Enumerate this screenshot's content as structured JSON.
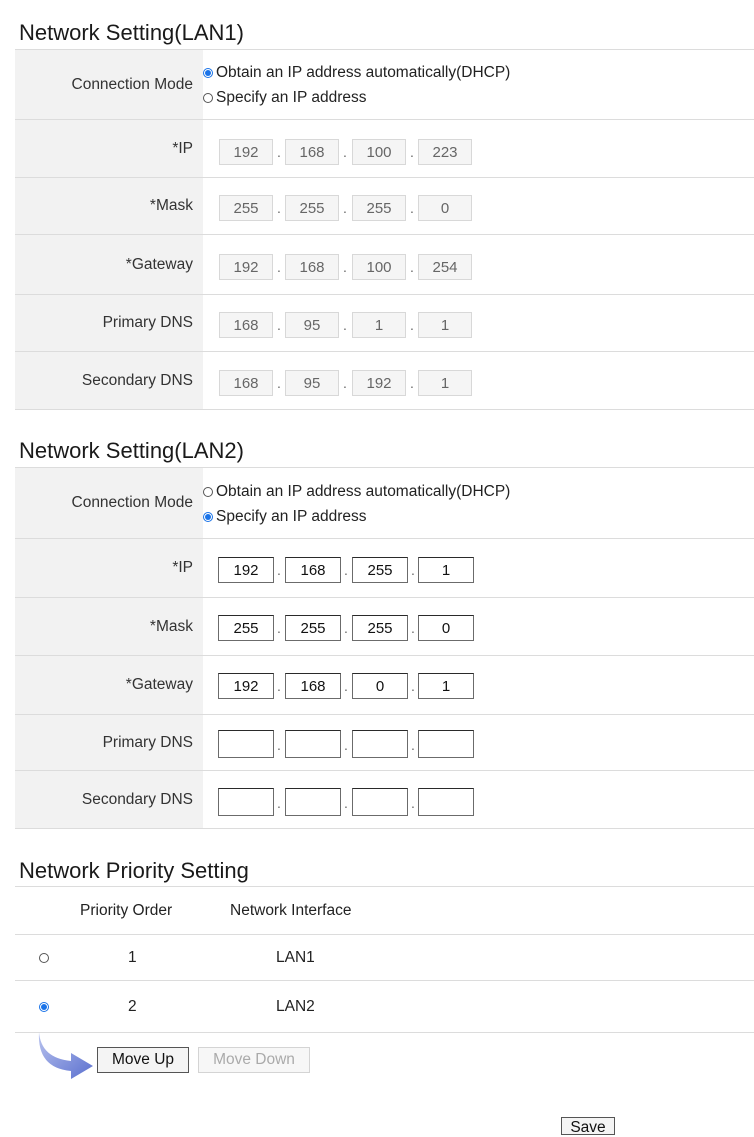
{
  "lan1": {
    "title": "Network Setting(LAN1)",
    "connection_mode_label": "Connection Mode",
    "mode_options": [
      "Obtain an IP address automatically(DHCP)",
      "Specify an IP address"
    ],
    "selected_mode": 0,
    "fields_enabled": false,
    "fields": [
      {
        "label": "*IP",
        "octets": [
          "192",
          "168",
          "100",
          "223"
        ]
      },
      {
        "label": "*Mask",
        "octets": [
          "255",
          "255",
          "255",
          "0"
        ]
      },
      {
        "label": "*Gateway",
        "octets": [
          "192",
          "168",
          "100",
          "254"
        ]
      },
      {
        "label": "Primary DNS",
        "octets": [
          "168",
          "95",
          "1",
          "1"
        ]
      },
      {
        "label": "Secondary DNS",
        "octets": [
          "168",
          "95",
          "192",
          "1"
        ]
      }
    ]
  },
  "lan2": {
    "title": "Network Setting(LAN2)",
    "connection_mode_label": "Connection Mode",
    "mode_options": [
      "Obtain an IP address automatically(DHCP)",
      "Specify an IP address"
    ],
    "selected_mode": 1,
    "fields_enabled": true,
    "fields": [
      {
        "label": "*IP",
        "octets": [
          "192",
          "168",
          "255",
          "1"
        ]
      },
      {
        "label": "*Mask",
        "octets": [
          "255",
          "255",
          "255",
          "0"
        ]
      },
      {
        "label": "*Gateway",
        "octets": [
          "192",
          "168",
          "0",
          "1"
        ]
      },
      {
        "label": "Primary DNS",
        "octets": [
          "",
          "",
          "",
          ""
        ]
      },
      {
        "label": "Secondary DNS",
        "octets": [
          "",
          "",
          "",
          ""
        ]
      }
    ]
  },
  "priority": {
    "title": "Network Priority Setting",
    "headers": [
      "Priority Order",
      "Network Interface"
    ],
    "rows": [
      {
        "order": "1",
        "interface": "LAN1",
        "selected": false
      },
      {
        "order": "2",
        "interface": "LAN2",
        "selected": true
      }
    ],
    "arrow_icon": "curved-arrow-icon",
    "move_up_label": "Move Up",
    "move_down_label": "Move Down"
  },
  "save_label": "Save",
  "colors": {
    "accent": "#1a73e8",
    "label_bg": "#f2f2f2",
    "arrow": "#6a7fd6"
  }
}
